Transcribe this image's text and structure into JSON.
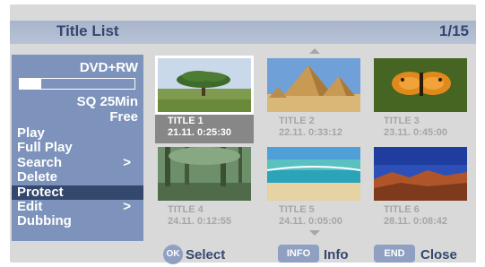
{
  "header": {
    "title": "Title List",
    "page_indicator": "1/15"
  },
  "sidebar": {
    "disc_type": "DVD+RW",
    "capacity_used_fraction": 0.19,
    "quality": "SQ  25Min",
    "free_label": "Free",
    "menu": [
      {
        "label": "Play",
        "has_submenu": false,
        "selected": false
      },
      {
        "label": "Full Play",
        "has_submenu": false,
        "selected": false
      },
      {
        "label": "Search",
        "has_submenu": true,
        "selected": false
      },
      {
        "label": "Delete",
        "has_submenu": false,
        "selected": false
      },
      {
        "label": "Protect",
        "has_submenu": false,
        "selected": true
      },
      {
        "label": "Edit",
        "has_submenu": true,
        "selected": false
      },
      {
        "label": "Dubbing",
        "has_submenu": false,
        "selected": false
      }
    ],
    "submenu_arrow": ">"
  },
  "titles": [
    {
      "name": "TITLE 1",
      "date": "21.11.",
      "duration": "0:25:30",
      "scene": "tree",
      "selected": true
    },
    {
      "name": "TITLE 2",
      "date": "22.11.",
      "duration": "0:33:12",
      "scene": "pyramids",
      "selected": false
    },
    {
      "name": "TITLE 3",
      "date": "23.11.",
      "duration": "0:45:00",
      "scene": "butterfly",
      "selected": false
    },
    {
      "name": "TITLE 4",
      "date": "24.11.",
      "duration": "0:12:55",
      "scene": "forest",
      "selected": false
    },
    {
      "name": "TITLE 5",
      "date": "24.11.",
      "duration": "0:05:00",
      "scene": "beach",
      "selected": false
    },
    {
      "name": "TITLE 6",
      "date": "28.11.",
      "duration": "0:08:42",
      "scene": "canyon",
      "selected": false
    }
  ],
  "footer": {
    "ok_key": "OK",
    "ok_label": "Select",
    "info_key": "INFO",
    "info_label": "Info",
    "end_key": "END",
    "end_label": "Close"
  },
  "colors": {
    "title_text": "#34476d",
    "sidebar_bg": "#7e93bb",
    "selected_bg": "#34476d",
    "panel_bg": "#d9d9d9",
    "dim_text": "#a6a6a6"
  }
}
